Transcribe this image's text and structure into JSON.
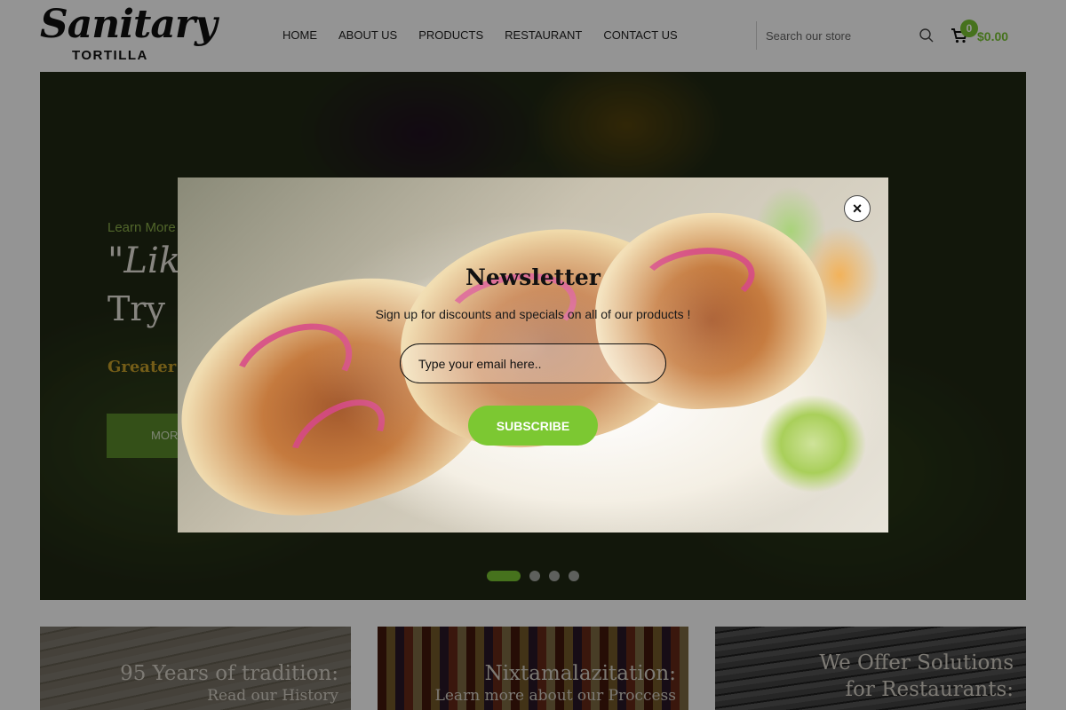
{
  "brand": {
    "name": "Sanitary",
    "sub": "TORTILLA"
  },
  "nav": {
    "items": [
      {
        "label": "HOME"
      },
      {
        "label": "ABOUT US"
      },
      {
        "label": "PRODUCTS"
      },
      {
        "label": "RESTAURANT"
      },
      {
        "label": "CONTACT US"
      }
    ]
  },
  "search": {
    "placeholder": "Search our store",
    "value": ""
  },
  "cart": {
    "count": "0",
    "total": "$0.00"
  },
  "hero": {
    "kicker": "Learn More",
    "line1": "\"Like",
    "line2": "Try",
    "sub": "Greater I",
    "button_label": "MORE",
    "active_slide": 1,
    "slide_count": 4
  },
  "cards": [
    {
      "title": "95 Years of tradition:",
      "sub": "Read our History"
    },
    {
      "title": "Nixtamalazitation:",
      "sub": "Learn more about our Proccess"
    },
    {
      "title": "We Offer Solutions",
      "sub": "for Restaurants:"
    }
  ],
  "newsletter": {
    "title": "Newsletter",
    "subtitle": "Sign up for discounts and specials on all of our products !",
    "email_placeholder": "Type your email here..",
    "email_value": "",
    "subscribe_label": "SUBSCRIBE",
    "close_label": "×"
  },
  "colors": {
    "accent": "#7cc832",
    "cart_green": "#79c533"
  },
  "icons": {
    "search": "search-icon",
    "cart": "cart-icon",
    "close": "close-icon"
  }
}
